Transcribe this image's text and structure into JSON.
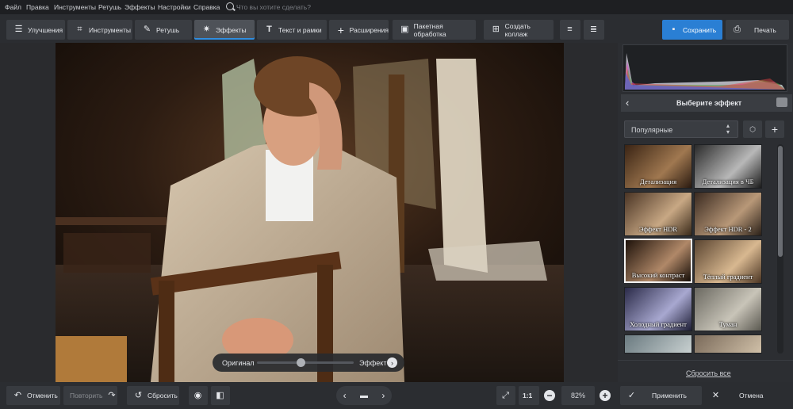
{
  "menu": {
    "items": [
      "Файл",
      "Правка",
      "Инструменты",
      "Ретушь",
      "Эффекты",
      "Настройки",
      "Справка"
    ]
  },
  "search": {
    "placeholder": "Что вы хотите сделать?"
  },
  "toolbar": {
    "tabs": [
      {
        "label": "Улучшения",
        "icon": "sliders-icon",
        "active": false
      },
      {
        "label": "Инструменты",
        "icon": "crop-icon",
        "active": false
      },
      {
        "label": "Ретушь",
        "icon": "brush-icon",
        "active": false
      },
      {
        "label": "Эффекты",
        "icon": "sparkle-icon",
        "active": true
      },
      {
        "label": "Текст и рамки",
        "icon": "text-icon",
        "active": false
      },
      {
        "label": "Расширения",
        "icon": "plus-icon",
        "active": false
      }
    ],
    "batch_label": "Пакетная обработка",
    "collage_label": "Создать коллаж",
    "save_label": "Сохранить",
    "print_label": "Печать"
  },
  "compare": {
    "original_label": "Оригинал",
    "effect_label": "Эффект",
    "slider_position": 0.45
  },
  "panel": {
    "title": "Выберите эффект",
    "category": "Популярные",
    "reset_all_label": "Сбросить все",
    "effects": [
      {
        "label": "Детализация",
        "selected": false
      },
      {
        "label": "Детализация в ЧБ",
        "selected": false
      },
      {
        "label": "Эффект HDR",
        "selected": false
      },
      {
        "label": "Эффект HDR - 2",
        "selected": false
      },
      {
        "label": "Высокий контраст",
        "selected": true
      },
      {
        "label": "Тёплый градиент",
        "selected": false
      },
      {
        "label": "Холодный градиент",
        "selected": false
      },
      {
        "label": "Туман",
        "selected": false
      },
      {
        "label": "",
        "selected": false
      },
      {
        "label": "",
        "selected": false
      }
    ]
  },
  "bottom": {
    "undo_label": "Отменить",
    "redo_label": "Повторить",
    "reset_label": "Сбросить",
    "ratio_label": "1:1",
    "zoom_value": "82%",
    "apply_label": "Применить",
    "cancel_label": "Отмена"
  },
  "colors": {
    "accent": "#2a7fd4",
    "toolbar_bg": "#2b2d31",
    "panel_bg": "#2c2e32"
  }
}
